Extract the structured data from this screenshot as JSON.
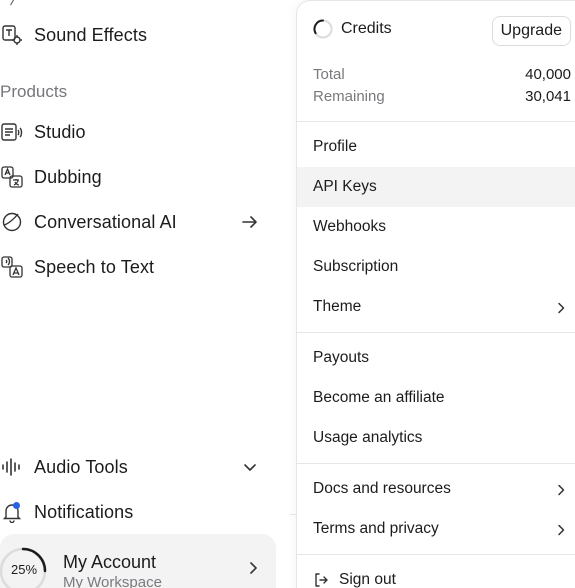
{
  "sidebar": {
    "items_top": [
      {
        "label": "Sound Effects",
        "icon": "sound-effects-icon"
      }
    ],
    "section_label": "Products",
    "products": [
      {
        "label": "Studio",
        "icon": "studio-icon"
      },
      {
        "label": "Dubbing",
        "icon": "dubbing-icon"
      },
      {
        "label": "Conversational AI",
        "icon": "conversational-ai-icon",
        "trailing": "arrow-right-icon"
      },
      {
        "label": "Speech to Text",
        "icon": "speech-to-text-icon"
      }
    ],
    "bottom": [
      {
        "label": "Audio Tools",
        "icon": "audio-tools-icon",
        "trailing": "chevron-down-icon"
      },
      {
        "label": "Notifications",
        "icon": "bell-icon",
        "badge_color": "#2563eb"
      }
    ],
    "account": {
      "progress": "25%",
      "progress_fraction": 0.25,
      "name": "My Account",
      "workspace": "My Workspace"
    }
  },
  "popover": {
    "credits": {
      "title": "Credits",
      "upgrade_label": "Upgrade",
      "total_label": "Total",
      "total_value": "40,000",
      "remaining_label": "Remaining",
      "remaining_value": "30,041"
    },
    "group1": [
      {
        "label": "Profile"
      },
      {
        "label": "API Keys",
        "highlighted": true
      },
      {
        "label": "Webhooks"
      },
      {
        "label": "Subscription"
      },
      {
        "label": "Theme",
        "chevron": true
      }
    ],
    "group2": [
      {
        "label": "Payouts"
      },
      {
        "label": "Become an affiliate"
      },
      {
        "label": "Usage analytics"
      }
    ],
    "group3": [
      {
        "label": "Docs and resources",
        "chevron": true
      },
      {
        "label": "Terms and privacy",
        "chevron": true
      }
    ],
    "signout_label": "Sign out"
  },
  "colors": {
    "text": "#1c1c1e",
    "muted": "#7a7a7e",
    "hover_bg": "#f3f3f4",
    "border": "#e6e6e8",
    "badge": "#2563eb"
  }
}
